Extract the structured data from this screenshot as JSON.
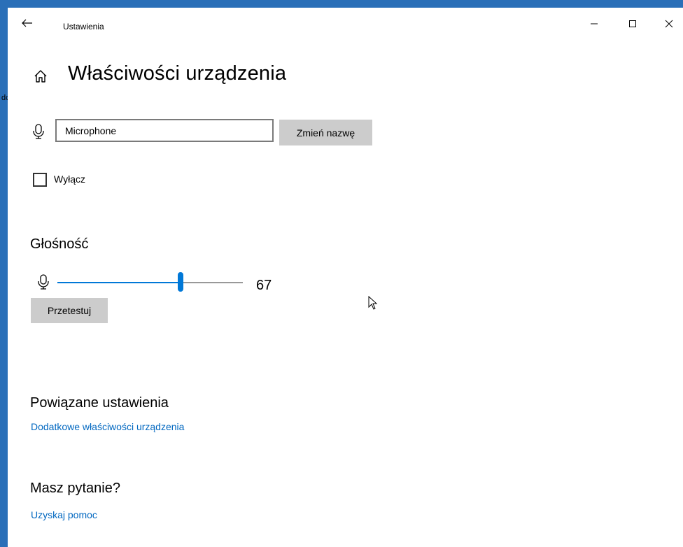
{
  "window": {
    "title": "Ustawienia"
  },
  "page": {
    "title": "Właściwości urządzenia"
  },
  "device": {
    "name_value": "Microphone",
    "rename_label": "Zmień nazwę",
    "disable_label": "Wyłącz",
    "disable_checked": false
  },
  "volume": {
    "heading": "Głośność",
    "value": "67",
    "level_percent": 67,
    "test_label": "Przetestuj"
  },
  "related": {
    "heading": "Powiązane ustawienia",
    "link_label": "Dodatkowe właściwości urządzenia"
  },
  "help": {
    "heading": "Masz pytanie?",
    "link_label": "Uzyskaj pomoc"
  },
  "colors": {
    "accent": "#0078d7",
    "link": "#0067c0",
    "desktop": "#2a6fb8",
    "button_bg": "#cccccc"
  },
  "icons": [
    "back-arrow-icon",
    "minimize-icon",
    "maximize-icon",
    "close-icon",
    "home-icon",
    "microphone-icon",
    "mouse-cursor-icon"
  ]
}
